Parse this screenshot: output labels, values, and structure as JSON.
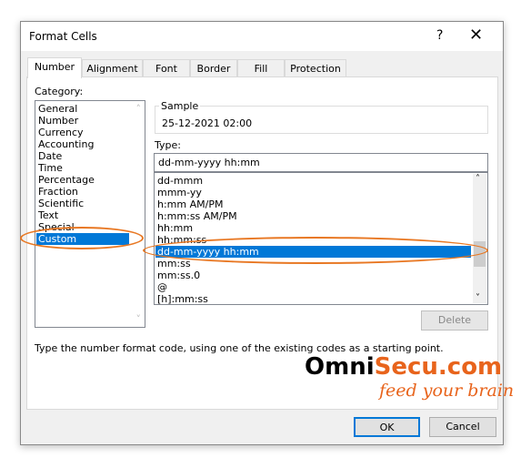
{
  "dialog": {
    "title": "Format Cells",
    "help": "?",
    "close": "✕"
  },
  "tabs": [
    "Number",
    "Alignment",
    "Font",
    "Border",
    "Fill",
    "Protection"
  ],
  "category": {
    "label": "Category:",
    "items": [
      "General",
      "Number",
      "Currency",
      "Accounting",
      "Date",
      "Time",
      "Percentage",
      "Fraction",
      "Scientific",
      "Text",
      "Special",
      "Custom"
    ],
    "selected": "Custom"
  },
  "sample": {
    "label": "Sample",
    "value": "25-12-2021 02:00"
  },
  "type": {
    "label": "Type:",
    "value": "dd-mm-yyyy hh:mm",
    "items": [
      "dd-mmm",
      "mmm-yy",
      "h:mm AM/PM",
      "h:mm:ss AM/PM",
      "hh:mm",
      "hh:mm:ss",
      "dd-mm-yyyy hh:mm",
      "mm:ss",
      "mm:ss.0",
      "@",
      "[h]:mm:ss"
    ],
    "selected": "dd-mm-yyyy hh:mm"
  },
  "delete_label": "Delete",
  "description": "Type the number format code, using one of the existing codes as a starting point.",
  "logo": {
    "part1": "Omni",
    "part2": "Secu.com",
    "tagline": "feed your brain",
    "accent": "#e8641c"
  },
  "ok_label": "OK",
  "cancel_label": "Cancel",
  "highlight_color": "#e87722"
}
